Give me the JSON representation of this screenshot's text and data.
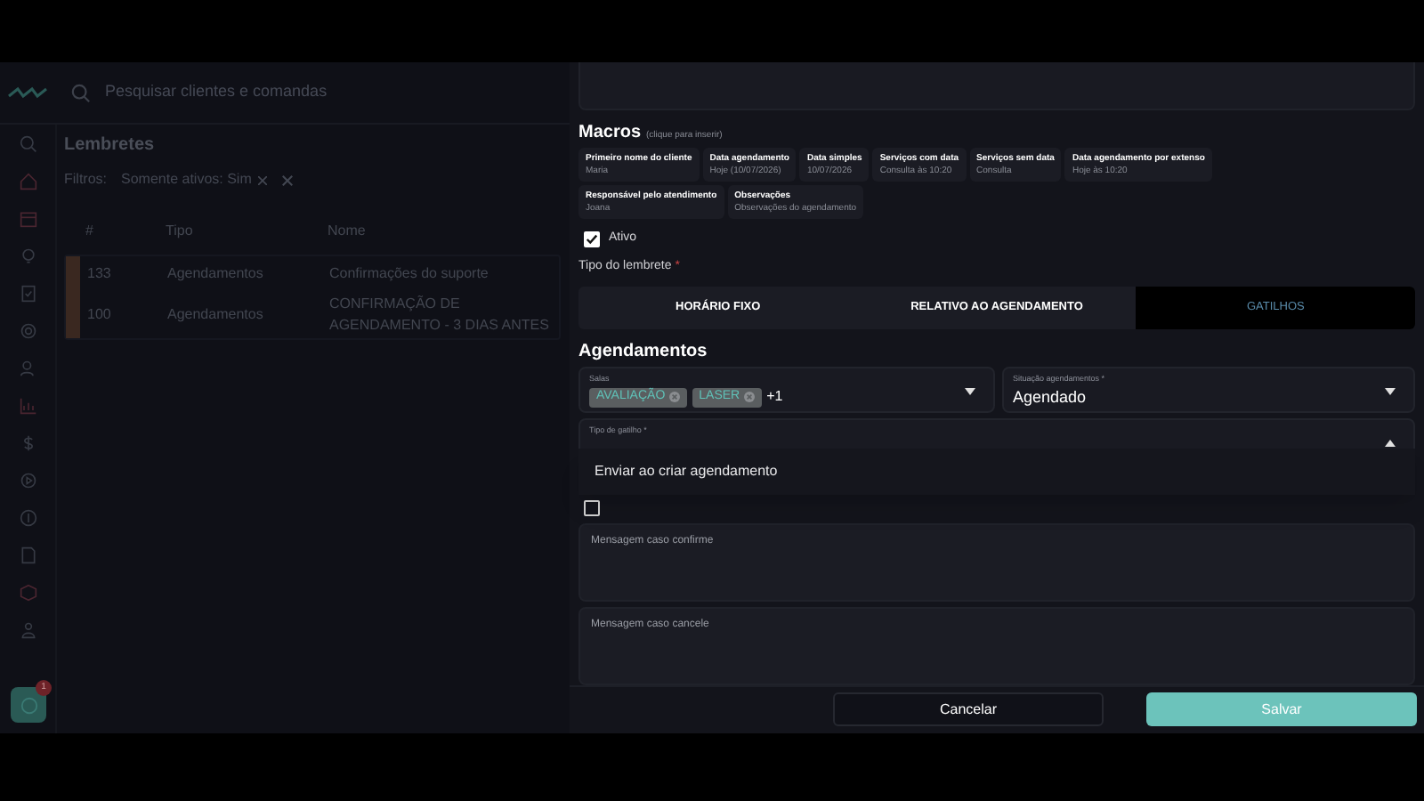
{
  "search": {
    "placeholder": "Pesquisar clientes e comandas"
  },
  "chat_badge": "1",
  "list": {
    "title": "Lembretes",
    "filters_label": "Filtros:",
    "filter_chip": "Somente ativos: Sim",
    "columns": [
      "#",
      "Tipo",
      "Nome"
    ],
    "rows": [
      {
        "id": "133",
        "type": "Agendamentos",
        "name": "Confirmações do suporte"
      },
      {
        "id": "100",
        "type": "Agendamentos",
        "name": "CONFIRMAÇÃO DE AGENDAMENTO - 3 DIAS ANTES"
      }
    ]
  },
  "form": {
    "macros_title": "Macros",
    "macros_hint": "(clique para inserir)",
    "macros": [
      {
        "label": "Primeiro nome do cliente",
        "example": "Maria"
      },
      {
        "label": "Data agendamento",
        "example": "Hoje (10/07/2026)"
      },
      {
        "label": "Data simples",
        "example": "10/07/2026"
      },
      {
        "label": "Serviços com data",
        "example": "Consulta às 10:20"
      },
      {
        "label": "Serviços sem data",
        "example": "Consulta"
      },
      {
        "label": "Data agendamento por extenso",
        "example": "Hoje às 10:20"
      },
      {
        "label": "Responsável pelo atendimento",
        "example": "Joana"
      },
      {
        "label": "Observações",
        "example": "Observações do agendamento"
      }
    ],
    "active": {
      "label": "Ativo",
      "checked": true
    },
    "type_label": "Tipo do lembrete",
    "required_mark": "*",
    "tabs": [
      {
        "label": "HORÁRIO FIXO",
        "selected": false
      },
      {
        "label": "RELATIVO AO AGENDAMENTO",
        "selected": false
      },
      {
        "label": "GATILHOS",
        "selected": true
      }
    ],
    "section_title": "Agendamentos",
    "rooms": {
      "label": "Salas",
      "chips": [
        "AVALIAÇÃO",
        "LASER"
      ],
      "more": "+1"
    },
    "status": {
      "label": "Situação agendamentos",
      "required_mark": "*",
      "value": "Agendado"
    },
    "trigger": {
      "label": "Tipo de gatilho",
      "required_mark": "*",
      "expanded": true,
      "options": [
        "Enviar ao criar agendamento"
      ]
    },
    "confirm_button_checkbox": {
      "checked": false
    },
    "messages": [
      {
        "placeholder": "Mensagem caso confirme"
      },
      {
        "placeholder": "Mensagem caso cancele"
      }
    ],
    "buttons": {
      "cancel": "Cancelar",
      "save": "Salvar"
    }
  }
}
